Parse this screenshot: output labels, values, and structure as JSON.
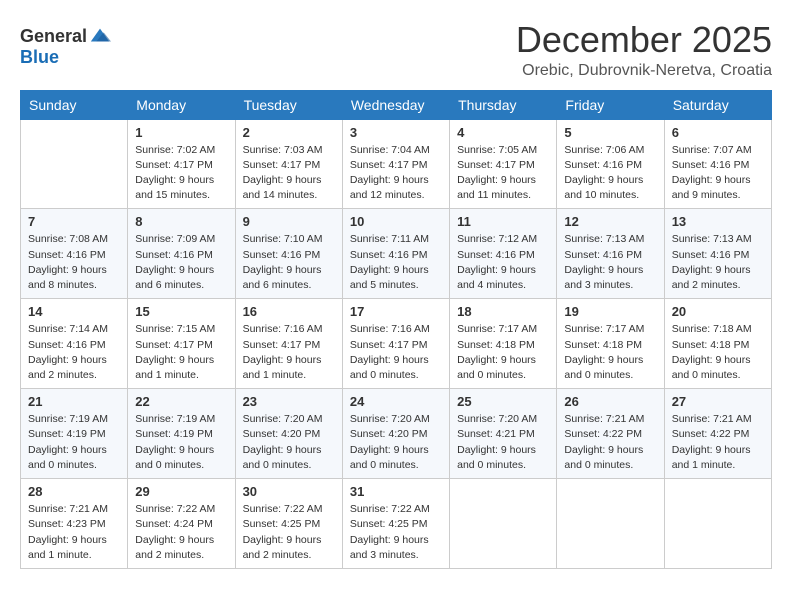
{
  "logo": {
    "general": "General",
    "blue": "Blue"
  },
  "title": {
    "month_year": "December 2025",
    "location": "Orebic, Dubrovnik-Neretva, Croatia"
  },
  "days_of_week": [
    "Sunday",
    "Monday",
    "Tuesday",
    "Wednesday",
    "Thursday",
    "Friday",
    "Saturday"
  ],
  "weeks": [
    [
      {
        "day": "",
        "info": ""
      },
      {
        "day": "1",
        "info": "Sunrise: 7:02 AM\nSunset: 4:17 PM\nDaylight: 9 hours\nand 15 minutes."
      },
      {
        "day": "2",
        "info": "Sunrise: 7:03 AM\nSunset: 4:17 PM\nDaylight: 9 hours\nand 14 minutes."
      },
      {
        "day": "3",
        "info": "Sunrise: 7:04 AM\nSunset: 4:17 PM\nDaylight: 9 hours\nand 12 minutes."
      },
      {
        "day": "4",
        "info": "Sunrise: 7:05 AM\nSunset: 4:17 PM\nDaylight: 9 hours\nand 11 minutes."
      },
      {
        "day": "5",
        "info": "Sunrise: 7:06 AM\nSunset: 4:16 PM\nDaylight: 9 hours\nand 10 minutes."
      },
      {
        "day": "6",
        "info": "Sunrise: 7:07 AM\nSunset: 4:16 PM\nDaylight: 9 hours\nand 9 minutes."
      }
    ],
    [
      {
        "day": "7",
        "info": "Sunrise: 7:08 AM\nSunset: 4:16 PM\nDaylight: 9 hours\nand 8 minutes."
      },
      {
        "day": "8",
        "info": "Sunrise: 7:09 AM\nSunset: 4:16 PM\nDaylight: 9 hours\nand 6 minutes."
      },
      {
        "day": "9",
        "info": "Sunrise: 7:10 AM\nSunset: 4:16 PM\nDaylight: 9 hours\nand 6 minutes."
      },
      {
        "day": "10",
        "info": "Sunrise: 7:11 AM\nSunset: 4:16 PM\nDaylight: 9 hours\nand 5 minutes."
      },
      {
        "day": "11",
        "info": "Sunrise: 7:12 AM\nSunset: 4:16 PM\nDaylight: 9 hours\nand 4 minutes."
      },
      {
        "day": "12",
        "info": "Sunrise: 7:13 AM\nSunset: 4:16 PM\nDaylight: 9 hours\nand 3 minutes."
      },
      {
        "day": "13",
        "info": "Sunrise: 7:13 AM\nSunset: 4:16 PM\nDaylight: 9 hours\nand 2 minutes."
      }
    ],
    [
      {
        "day": "14",
        "info": "Sunrise: 7:14 AM\nSunset: 4:16 PM\nDaylight: 9 hours\nand 2 minutes."
      },
      {
        "day": "15",
        "info": "Sunrise: 7:15 AM\nSunset: 4:17 PM\nDaylight: 9 hours\nand 1 minute."
      },
      {
        "day": "16",
        "info": "Sunrise: 7:16 AM\nSunset: 4:17 PM\nDaylight: 9 hours\nand 1 minute."
      },
      {
        "day": "17",
        "info": "Sunrise: 7:16 AM\nSunset: 4:17 PM\nDaylight: 9 hours\nand 0 minutes."
      },
      {
        "day": "18",
        "info": "Sunrise: 7:17 AM\nSunset: 4:18 PM\nDaylight: 9 hours\nand 0 minutes."
      },
      {
        "day": "19",
        "info": "Sunrise: 7:17 AM\nSunset: 4:18 PM\nDaylight: 9 hours\nand 0 minutes."
      },
      {
        "day": "20",
        "info": "Sunrise: 7:18 AM\nSunset: 4:18 PM\nDaylight: 9 hours\nand 0 minutes."
      }
    ],
    [
      {
        "day": "21",
        "info": "Sunrise: 7:19 AM\nSunset: 4:19 PM\nDaylight: 9 hours\nand 0 minutes."
      },
      {
        "day": "22",
        "info": "Sunrise: 7:19 AM\nSunset: 4:19 PM\nDaylight: 9 hours\nand 0 minutes."
      },
      {
        "day": "23",
        "info": "Sunrise: 7:20 AM\nSunset: 4:20 PM\nDaylight: 9 hours\nand 0 minutes."
      },
      {
        "day": "24",
        "info": "Sunrise: 7:20 AM\nSunset: 4:20 PM\nDaylight: 9 hours\nand 0 minutes."
      },
      {
        "day": "25",
        "info": "Sunrise: 7:20 AM\nSunset: 4:21 PM\nDaylight: 9 hours\nand 0 minutes."
      },
      {
        "day": "26",
        "info": "Sunrise: 7:21 AM\nSunset: 4:22 PM\nDaylight: 9 hours\nand 0 minutes."
      },
      {
        "day": "27",
        "info": "Sunrise: 7:21 AM\nSunset: 4:22 PM\nDaylight: 9 hours\nand 1 minute."
      }
    ],
    [
      {
        "day": "28",
        "info": "Sunrise: 7:21 AM\nSunset: 4:23 PM\nDaylight: 9 hours\nand 1 minute."
      },
      {
        "day": "29",
        "info": "Sunrise: 7:22 AM\nSunset: 4:24 PM\nDaylight: 9 hours\nand 2 minutes."
      },
      {
        "day": "30",
        "info": "Sunrise: 7:22 AM\nSunset: 4:25 PM\nDaylight: 9 hours\nand 2 minutes."
      },
      {
        "day": "31",
        "info": "Sunrise: 7:22 AM\nSunset: 4:25 PM\nDaylight: 9 hours\nand 3 minutes."
      },
      {
        "day": "",
        "info": ""
      },
      {
        "day": "",
        "info": ""
      },
      {
        "day": "",
        "info": ""
      }
    ]
  ]
}
